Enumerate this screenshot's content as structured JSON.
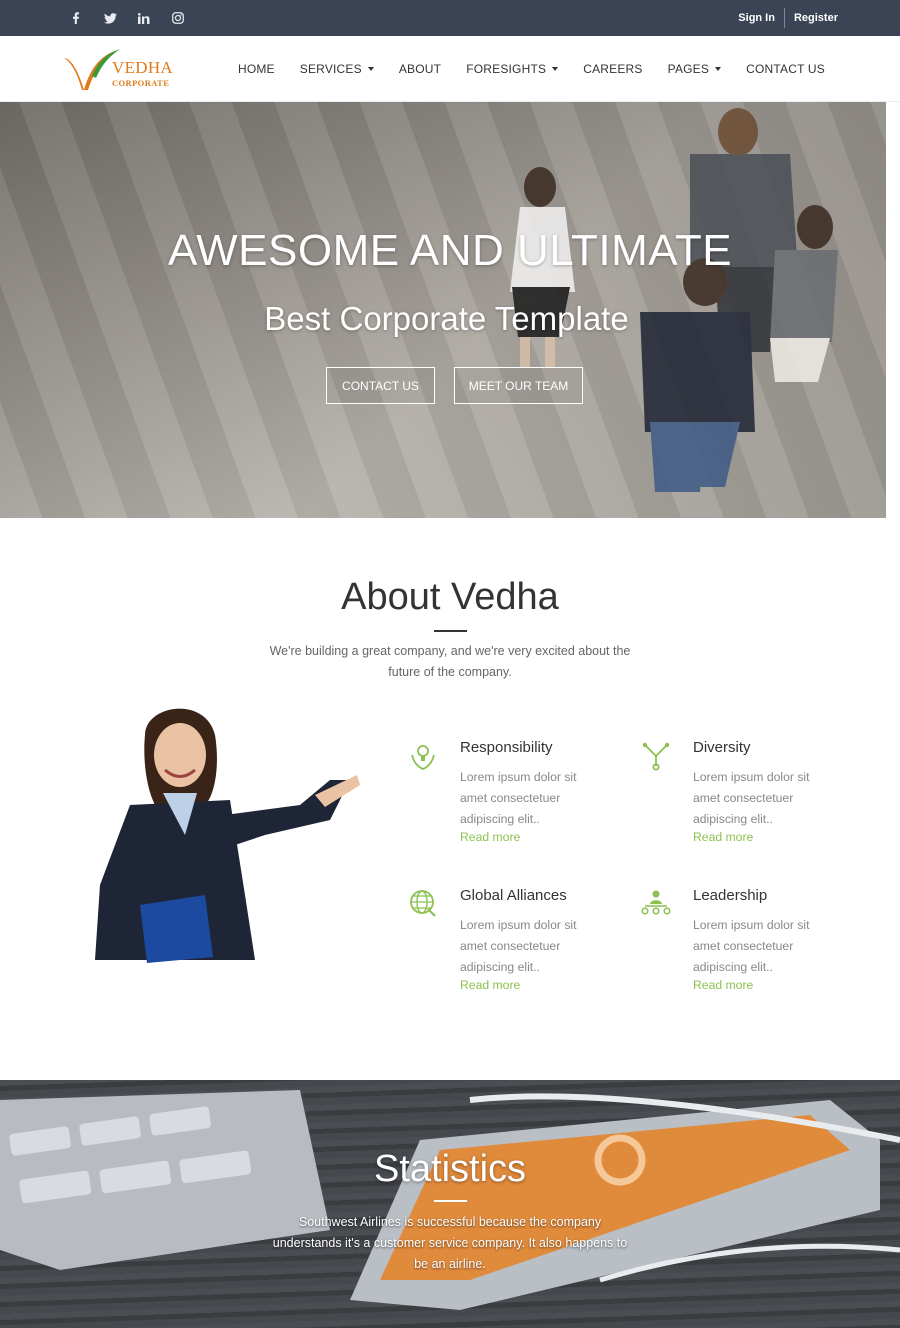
{
  "topbar": {
    "social": [
      "facebook-icon",
      "twitter-icon",
      "linkedin-icon",
      "instagram-icon"
    ],
    "sign_in": "Sign In",
    "register": "Register"
  },
  "brand": {
    "name": "VEDHA",
    "tagline": "CORPORATE",
    "accent_color": "#e07a1c"
  },
  "nav": {
    "items": [
      {
        "label": "HOME",
        "dropdown": false
      },
      {
        "label": "SERVICES",
        "dropdown": true
      },
      {
        "label": "ABOUT",
        "dropdown": false
      },
      {
        "label": "FORESIGHTS",
        "dropdown": true
      },
      {
        "label": "CAREERS",
        "dropdown": false
      },
      {
        "label": "PAGES",
        "dropdown": true
      },
      {
        "label": "CONTACT US",
        "dropdown": false
      }
    ]
  },
  "hero": {
    "title": "AWESOME AND ULTIMATE",
    "subtitle": "Best Corporate Template",
    "btn_contact": "CONTACT US",
    "btn_team": "MEET OUR TEAM"
  },
  "about": {
    "title": "About Vedha",
    "text": "We're building a great company, and we're very excited about the future of the company.",
    "features": [
      {
        "title": "Responsibility",
        "icon": "bulb-hands-icon",
        "text": "Lorem ipsum dolor sit amet consectetuer adipiscing elit..",
        "link": "Read more"
      },
      {
        "title": "Diversity",
        "icon": "branches-icon",
        "text": "Lorem ipsum dolor sit amet consectetuer adipiscing elit..",
        "link": "Read more"
      },
      {
        "title": "Global Alliances",
        "icon": "globe-icon",
        "text": "Lorem ipsum dolor sit amet consectetuer adipiscing elit..",
        "link": "Read more"
      },
      {
        "title": "Leadership",
        "icon": "leader-icon",
        "text": "Lorem ipsum dolor sit amet consectetuer adipiscing elit..",
        "link": "Read more"
      }
    ],
    "link_color": "#8cc152"
  },
  "stats": {
    "title": "Statistics",
    "text": "Southwest Airlines is successful because the company understands it's a customer service company. It also happens to be an airline."
  },
  "colors": {
    "topbar": "#3b4455",
    "green": "#8cc152"
  }
}
